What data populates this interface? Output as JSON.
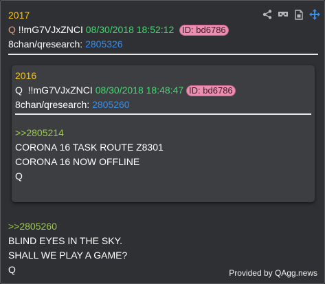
{
  "post": {
    "number": "2017",
    "q_prefix": "Q",
    "tripcode": "!!mG7VJxZNCI",
    "datetime": "08/30/2018 18:52:12",
    "id_badge": "ID: bd6786",
    "board": "8chan/qresearch:",
    "post_link": "2805326",
    "body_ref": ">>2805260",
    "body_lines": [
      "BLIND EYES IN THE SKY.",
      "SHALL WE PLAY A GAME?",
      "Q"
    ]
  },
  "quoted_post": {
    "number": "2016",
    "q_prefix": "Q",
    "tripcode": "!!mG7VJxZNCI",
    "datetime": "08/30/2018 18:48:47",
    "id_badge": "ID: bd6786",
    "board": "8chan/qresearch:",
    "post_link": "2805260",
    "body_ref": ">>2805214",
    "body_lines": [
      "CORONA 16 TASK ROUTE Z8301",
      "CORONA 16 NOW OFFLINE",
      "Q"
    ]
  },
  "toolbar": {
    "icons": [
      "share-icon",
      "vr-headset-icon",
      "document-icon",
      "move-arrows-icon"
    ]
  },
  "footer": {
    "credit": "Provided by QAgg.news"
  },
  "colors": {
    "post_number": "#f5c518",
    "datetime": "#3ddc6e",
    "link": "#3b8ee8",
    "reference": "#9ccc4a",
    "id_badge_bg": "#ea8fb0",
    "move_icon": "#3b8ee8"
  }
}
